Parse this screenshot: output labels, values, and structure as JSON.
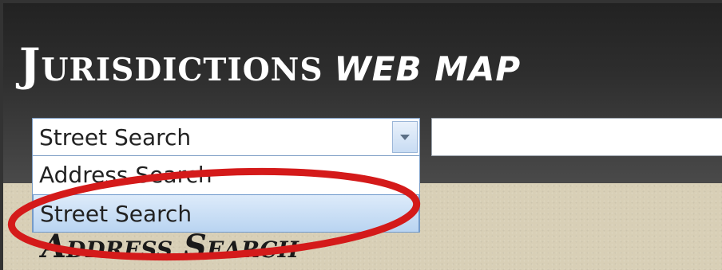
{
  "header": {
    "title_main": "Jurisdictions",
    "title_sub": "web map"
  },
  "search_type_select": {
    "selected_value": "Street Search",
    "options": [
      "Address Search",
      "Street Search"
    ],
    "highlighted_option": "Street Search"
  },
  "search_input": {
    "value": ""
  },
  "section": {
    "heading": "Address Search"
  },
  "colors": {
    "header_bg": "#2e2e2e",
    "content_bg": "#d8cfb6",
    "highlight_ring": "#d41a1a",
    "selected_option_bg": "#c9ddf4"
  }
}
